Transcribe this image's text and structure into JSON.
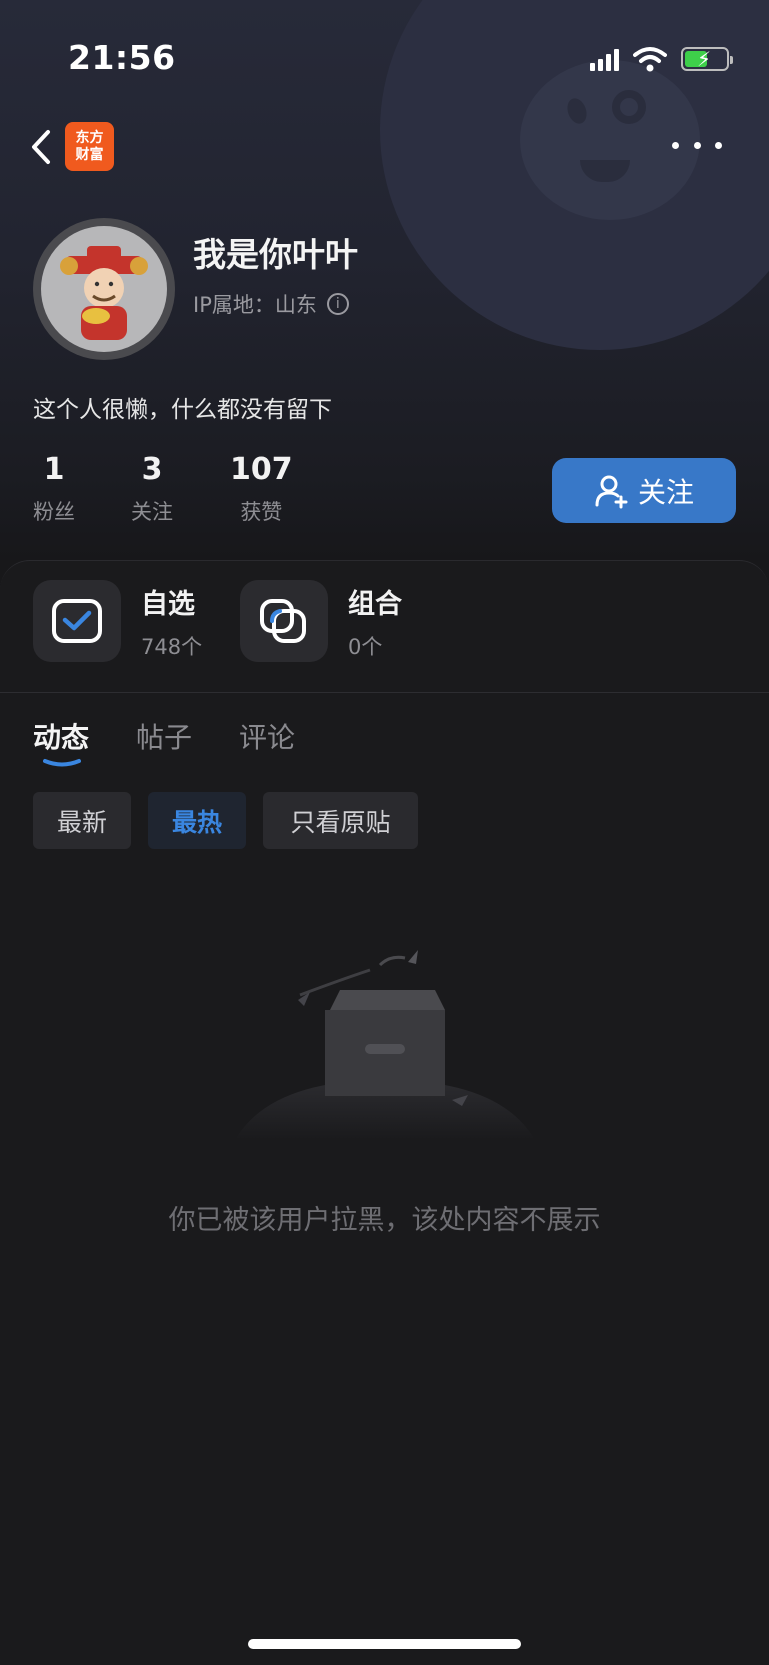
{
  "status_bar": {
    "time": "21:56"
  },
  "nav": {
    "logo_line1": "东方",
    "logo_line2": "财富"
  },
  "profile": {
    "username": "我是你叶叶",
    "ip_location": "IP属地：山东",
    "bio": "这个人很懒，什么都没有留下"
  },
  "stats": [
    {
      "num": "1",
      "label": "粉丝"
    },
    {
      "num": "3",
      "label": "关注"
    },
    {
      "num": "107",
      "label": "获赞"
    }
  ],
  "follow_button": {
    "label": "关注"
  },
  "shortcuts": [
    {
      "title": "自选",
      "sub": "748个"
    },
    {
      "title": "组合",
      "sub": "0个"
    }
  ],
  "tabs": [
    "动态",
    "帖子",
    "评论"
  ],
  "filters": [
    "最新",
    "最热",
    "只看原贴"
  ],
  "empty_message": "你已被该用户拉黑，该处内容不展示",
  "colors": {
    "accent": "#3878c8",
    "logo": "#f05a1e",
    "background": "#18181a"
  }
}
